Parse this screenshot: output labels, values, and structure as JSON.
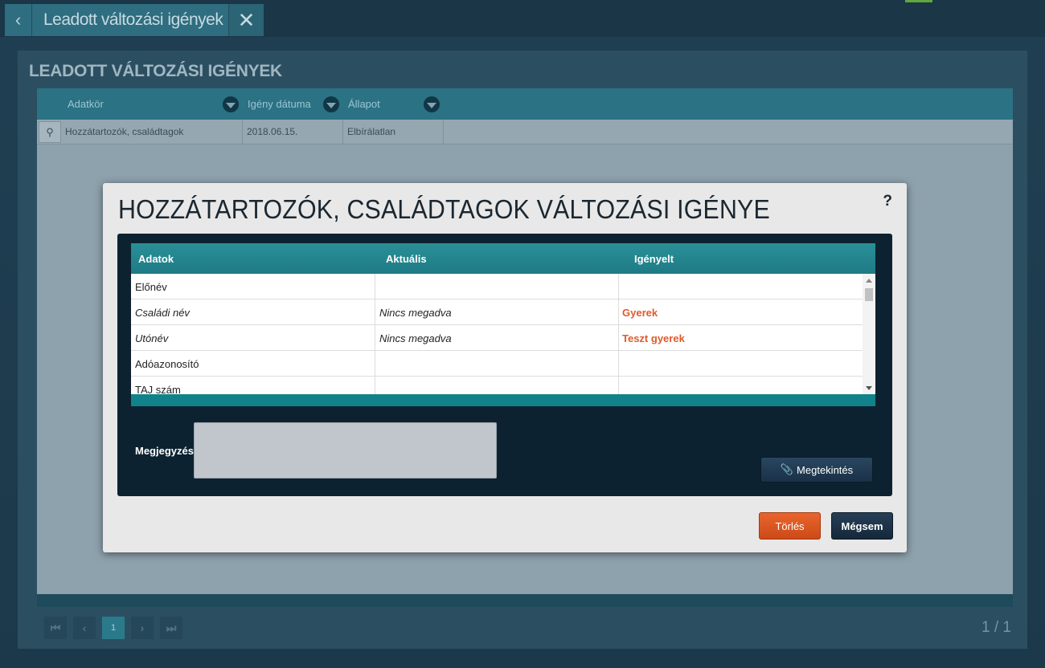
{
  "tab": {
    "back_icon": "chevron-left-icon",
    "title": "Leadott változási igények",
    "close_icon": "close-icon"
  },
  "panel": {
    "title": "LEADOTT VÁLTOZÁSI IGÉNYEK",
    "columns": [
      "Adatkör",
      "Igény dátuma",
      "Állapot"
    ],
    "rows": [
      {
        "adatkor": "Hozzátartozók, családtagok",
        "datum": "2018.06.15.",
        "allapot": "Elbírálatlan"
      }
    ],
    "pager": {
      "current_page": "1",
      "page_count": "1 / 1"
    }
  },
  "modal": {
    "title": "HOZZÁTARTOZÓK, CSALÁDTAGOK VÁLTOZÁSI IGÉNYE",
    "help": "?",
    "table": {
      "headers": [
        "Adatok",
        "Aktuális",
        "Igényelt"
      ],
      "rows": [
        {
          "adat": "Előnév",
          "aktualis": "",
          "igenyelt": ""
        },
        {
          "adat": "Családi név",
          "aktualis": "Nincs megadva",
          "igenyelt": "Gyerek"
        },
        {
          "adat": "Utónév",
          "aktualis": "Nincs megadva",
          "igenyelt": "Teszt gyerek"
        },
        {
          "adat": "Adóazonosító",
          "aktualis": "",
          "igenyelt": ""
        },
        {
          "adat": "TAJ szám",
          "aktualis": "",
          "igenyelt": ""
        }
      ]
    },
    "note_label": "Megjegyzés",
    "note_value": "",
    "view_button": "Megtekintés",
    "delete_button": "Törlés",
    "cancel_button": "Mégsem"
  },
  "colors": {
    "accent_teal": "#2b8f97",
    "requested_value": "#e05a2a",
    "delete_button": "#e9652d",
    "dark_button": "#1a3147"
  }
}
